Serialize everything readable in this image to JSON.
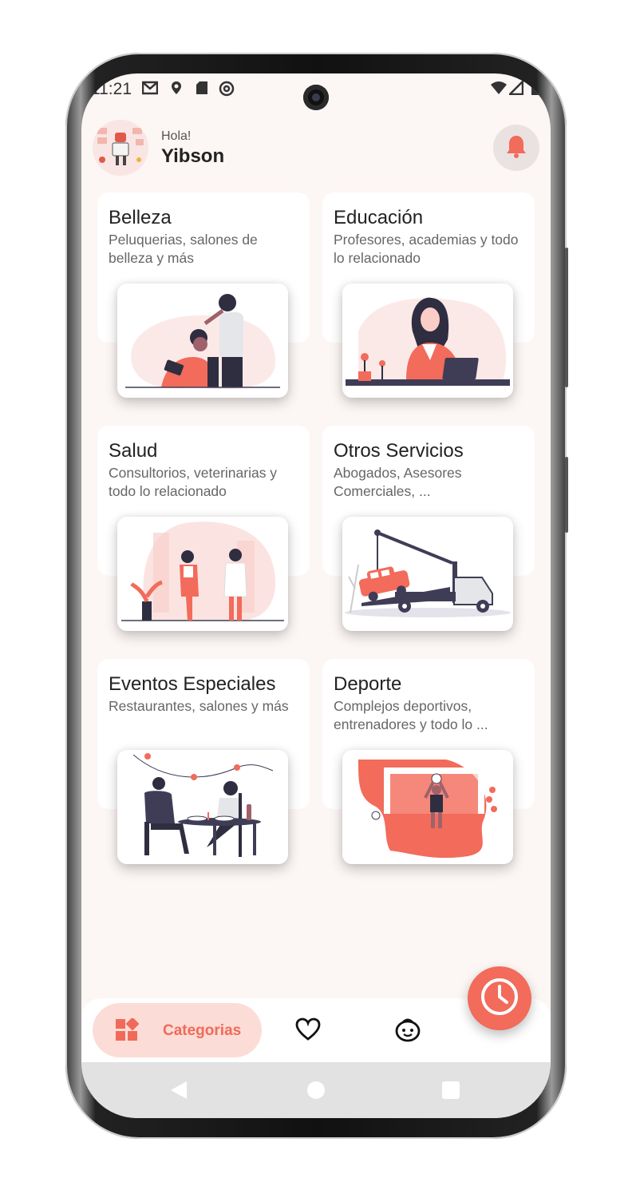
{
  "status_bar": {
    "time": "11:21"
  },
  "header": {
    "greeting": "Hola!",
    "user_name": "Yibson"
  },
  "categories": [
    {
      "title": "Belleza",
      "subtitle": "Peluquerias, salones de belleza y más"
    },
    {
      "title": "Educación",
      "subtitle": "Profesores, academias y todo lo relacionado"
    },
    {
      "title": "Salud",
      "subtitle": "Consultorios, veterinarias y todo lo relacionado"
    },
    {
      "title": "Otros Servicios",
      "subtitle": "Abogados, Asesores Comerciales, ..."
    },
    {
      "title": "Eventos Especiales",
      "subtitle": "Restaurantes, salones y más"
    },
    {
      "title": "Deporte",
      "subtitle": "Complejos deportivos, entrenadores y todo lo ..."
    }
  ],
  "bottom_nav": {
    "active_label": "Categorias"
  },
  "colors": {
    "accent": "#f26b5b",
    "accent_light": "#fcdcd6",
    "background": "#fcf6f4",
    "nav_text": "#f06a5a"
  },
  "icons": [
    "notification-bell-icon",
    "categories-grid-icon",
    "heart-icon",
    "face-icon",
    "clock-icon",
    "gmail-icon",
    "location-icon",
    "sd-card-icon",
    "sync-icon",
    "wifi-icon",
    "signal-icon",
    "battery-icon"
  ]
}
